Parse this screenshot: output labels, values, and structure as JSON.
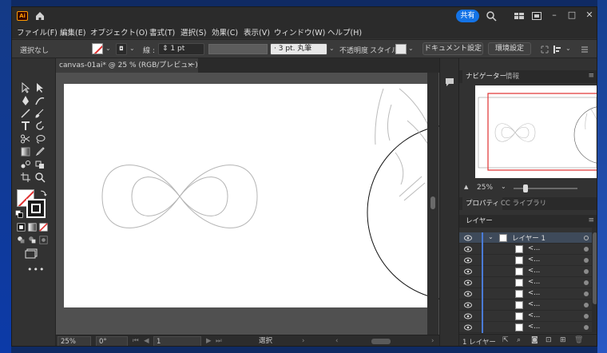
{
  "app": {
    "logo_text": "Ai",
    "share_label": "共有"
  },
  "menu": [
    "ファイル(F)",
    "編集(E)",
    "オブジェクト(O)",
    "書式(T)",
    "選択(S)",
    "効果(C)",
    "表示(V)",
    "ウィンドウ(W)",
    "ヘルプ(H)"
  ],
  "control": {
    "selection": "選択なし",
    "stroke_label": "線 :",
    "stroke_value": "1 pt",
    "brush_value": "3 pt. 丸筆",
    "opacity_label": "不透明度",
    "style_label": "スタイル :",
    "doc_settings": "ドキュメント設定",
    "prefs": "環境設定"
  },
  "document": {
    "tab_title": "canvas-01ai* @ 25 % (RGB/プレビュー)",
    "close": "×"
  },
  "status": {
    "zoom": "25%",
    "rotate": "0°",
    "artboard": "1",
    "mode": "選択"
  },
  "panels": {
    "navigator_tab": "ナビゲーター",
    "info_tab": "情報",
    "nav_zoom": "25%",
    "properties_tab": "プロパティ",
    "libraries_tab": "CC ライブラリ",
    "layers_tab": "レイヤー",
    "layer_name": "レイヤー 1",
    "sublayer_label": "<...",
    "footer_label": "1 レイヤー"
  }
}
